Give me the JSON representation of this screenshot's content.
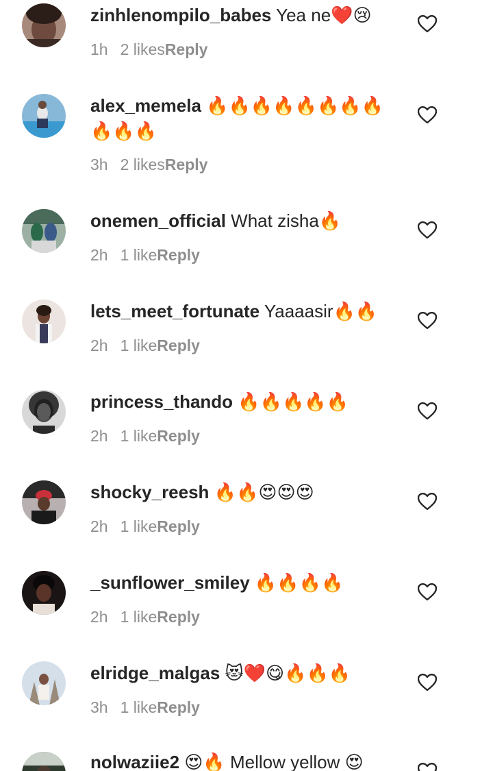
{
  "comments": [
    {
      "username": "zinhlenompilo_babes",
      "text": "Yea ne❤️😢",
      "time": "1h",
      "likes": "2 likes",
      "reply": "Reply",
      "avatar_color": "#8a6a5c"
    },
    {
      "username": "alex_memela",
      "text": "🔥🔥🔥🔥🔥🔥🔥🔥🔥🔥🔥",
      "time": "3h",
      "likes": "2 likes",
      "reply": "Reply",
      "avatar_color": "#6fa6c9"
    },
    {
      "username": "onemen_official",
      "text": "What zisha🔥",
      "time": "2h",
      "likes": "1 like",
      "reply": "Reply",
      "avatar_color": "#5b8c6b"
    },
    {
      "username": "lets_meet_fortunate",
      "text": "Yaaaasir🔥🔥",
      "time": "2h",
      "likes": "1 like",
      "reply": "Reply",
      "avatar_color": "#d8c8c0"
    },
    {
      "username": "princess_thando",
      "text": "🔥🔥🔥🔥🔥",
      "time": "2h",
      "likes": "1 like",
      "reply": "Reply",
      "avatar_color": "#555555"
    },
    {
      "username": "shocky_reesh",
      "text": "🔥🔥😍😍😍",
      "time": "2h",
      "likes": "1 like",
      "reply": "Reply",
      "avatar_color": "#3a3a3a"
    },
    {
      "username": "_sunflower_smiley",
      "text": "🔥🔥🔥🔥",
      "time": "2h",
      "likes": "1 like",
      "reply": "Reply",
      "avatar_color": "#4a3028"
    },
    {
      "username": "elridge_malgas",
      "text": "😻❤️😋🔥🔥🔥",
      "time": "3h",
      "likes": "1 like",
      "reply": "Reply",
      "avatar_color": "#c9d6e6"
    },
    {
      "username": "nolwaziie2",
      "text": "😍🔥 Mellow yellow 😍",
      "time": "",
      "likes": "",
      "reply": "",
      "avatar_color": "#2f3a2f"
    }
  ],
  "icons": {
    "like": "heart-outline-icon"
  },
  "colors": {
    "text": "#262626",
    "meta": "#8e8e8e",
    "background": "#ffffff"
  }
}
